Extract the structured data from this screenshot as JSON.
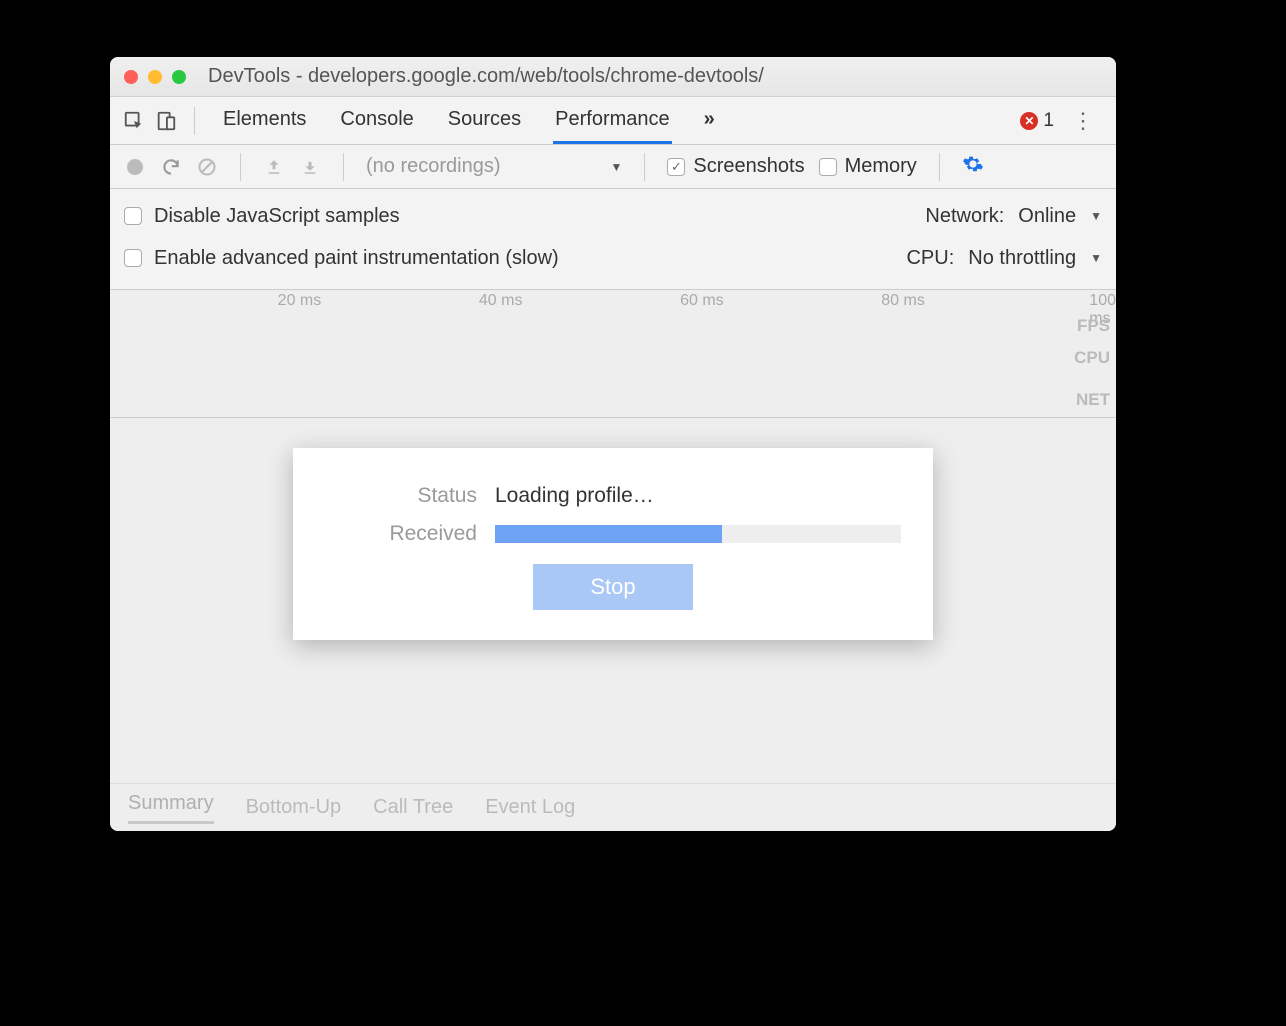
{
  "window": {
    "title": "DevTools - developers.google.com/web/tools/chrome-devtools/"
  },
  "tabs": {
    "items": [
      "Elements",
      "Console",
      "Sources",
      "Performance"
    ],
    "active": "Performance",
    "overflow_glyph": "»",
    "error_count": "1"
  },
  "recbar": {
    "recordings_label": "(no recordings)",
    "screenshots_label": "Screenshots",
    "screenshots_checked": true,
    "memory_label": "Memory",
    "memory_checked": false
  },
  "settings": {
    "disable_js_label": "Disable JavaScript samples",
    "enable_paint_label": "Enable advanced paint instrumentation (slow)",
    "network_label": "Network:",
    "network_value": "Online",
    "cpu_label": "CPU:",
    "cpu_value": "No throttling"
  },
  "ruler": {
    "ticks": [
      "20 ms",
      "40 ms",
      "60 ms",
      "80 ms",
      "100 ms"
    ],
    "lanes": [
      "FPS",
      "CPU",
      "NET"
    ]
  },
  "modal": {
    "status_label": "Status",
    "status_value": "Loading profile…",
    "received_label": "Received",
    "progress_pct": 56,
    "stop_label": "Stop"
  },
  "bottom_tabs": {
    "items": [
      "Summary",
      "Bottom-Up",
      "Call Tree",
      "Event Log"
    ],
    "active": "Summary"
  }
}
